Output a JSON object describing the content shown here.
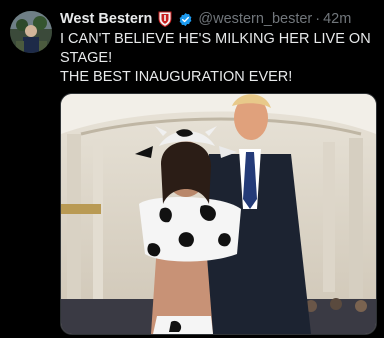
{
  "tweet": {
    "author": {
      "display_name": "West Bestern",
      "handle": "@western_bester",
      "avatar_icon": "avatar-image",
      "badges": [
        "shield-icon",
        "verified-icon"
      ]
    },
    "separator": "·",
    "timestamp": "42m",
    "text_lines": [
      "I CAN'T BELIEVE HE'S MILKING HER LIVE ON STAGE!",
      "THE BEST INAUGURATION EVER!"
    ],
    "media": {
      "icon": "photo-image"
    }
  },
  "colors": {
    "background": "#000000",
    "text": "#e7e9ea",
    "secondary_text": "#71767b",
    "verified_blue": "#1d9bf0",
    "shield_red": "#c81e1e"
  }
}
